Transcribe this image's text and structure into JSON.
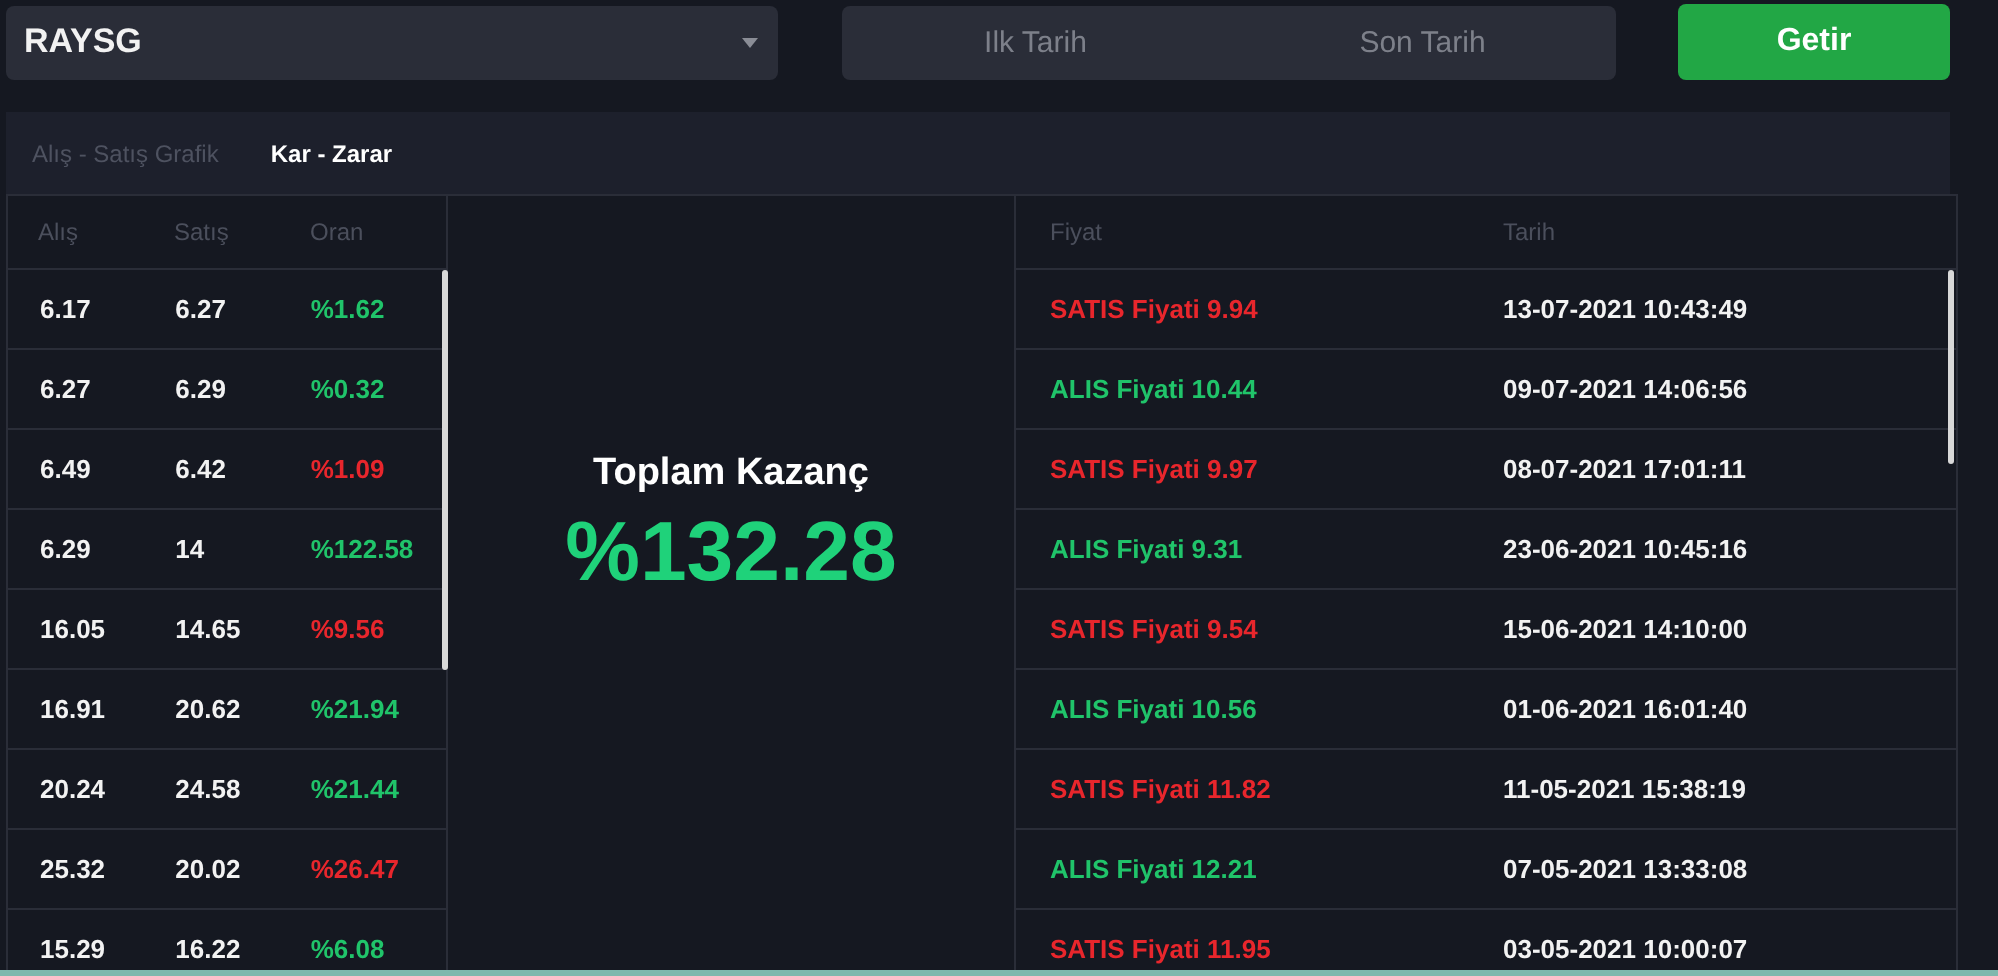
{
  "symbol_select": {
    "value": "RAYSG"
  },
  "date_range": {
    "start_placeholder": "Ilk Tarih",
    "end_placeholder": "Son Tarih"
  },
  "fetch_button": "Getir",
  "tabs": [
    {
      "label": "Alış - Satış Grafik",
      "selected": false
    },
    {
      "label": "Kar - Zarar",
      "selected": true
    }
  ],
  "trades_table": {
    "columns": [
      "Alış",
      "Satış",
      "Oran"
    ],
    "rows": [
      {
        "buy": "6.17",
        "sell": "6.27",
        "ratio": "%1.62",
        "kind": "gain"
      },
      {
        "buy": "6.27",
        "sell": "6.29",
        "ratio": "%0.32",
        "kind": "gain"
      },
      {
        "buy": "6.49",
        "sell": "6.42",
        "ratio": "%1.09",
        "kind": "loss"
      },
      {
        "buy": "6.29",
        "sell": "14",
        "ratio": "%122.58",
        "kind": "gain"
      },
      {
        "buy": "16.05",
        "sell": "14.65",
        "ratio": "%9.56",
        "kind": "loss"
      },
      {
        "buy": "16.91",
        "sell": "20.62",
        "ratio": "%21.94",
        "kind": "gain"
      },
      {
        "buy": "20.24",
        "sell": "24.58",
        "ratio": "%21.44",
        "kind": "gain"
      },
      {
        "buy": "25.32",
        "sell": "20.02",
        "ratio": "%26.47",
        "kind": "loss"
      },
      {
        "buy": "15.29",
        "sell": "16.22",
        "ratio": "%6.08",
        "kind": "gain"
      }
    ]
  },
  "total": {
    "label": "Toplam Kazanç",
    "value": "%132.28",
    "kind": "gain"
  },
  "orders_table": {
    "columns": [
      "Fiyat",
      "Tarih"
    ],
    "rows": [
      {
        "price": "SATIS Fiyati 9.94",
        "date": "13-07-2021 10:43:49",
        "kind": "sell"
      },
      {
        "price": "ALIS Fiyati 10.44",
        "date": "09-07-2021 14:06:56",
        "kind": "buy"
      },
      {
        "price": "SATIS Fiyati 9.97",
        "date": "08-07-2021 17:01:11",
        "kind": "sell"
      },
      {
        "price": "ALIS Fiyati 9.31",
        "date": "23-06-2021 10:45:16",
        "kind": "buy"
      },
      {
        "price": "SATIS Fiyati 9.54",
        "date": "15-06-2021 14:10:00",
        "kind": "sell"
      },
      {
        "price": "ALIS Fiyati 10.56",
        "date": "01-06-2021 16:01:40",
        "kind": "buy"
      },
      {
        "price": "SATIS Fiyati 11.82",
        "date": "11-05-2021 15:38:19",
        "kind": "sell"
      },
      {
        "price": "ALIS Fiyati 12.21",
        "date": "07-05-2021 13:33:08",
        "kind": "buy"
      },
      {
        "price": "SATIS Fiyati 11.95",
        "date": "03-05-2021 10:00:07",
        "kind": "sell"
      }
    ]
  }
}
